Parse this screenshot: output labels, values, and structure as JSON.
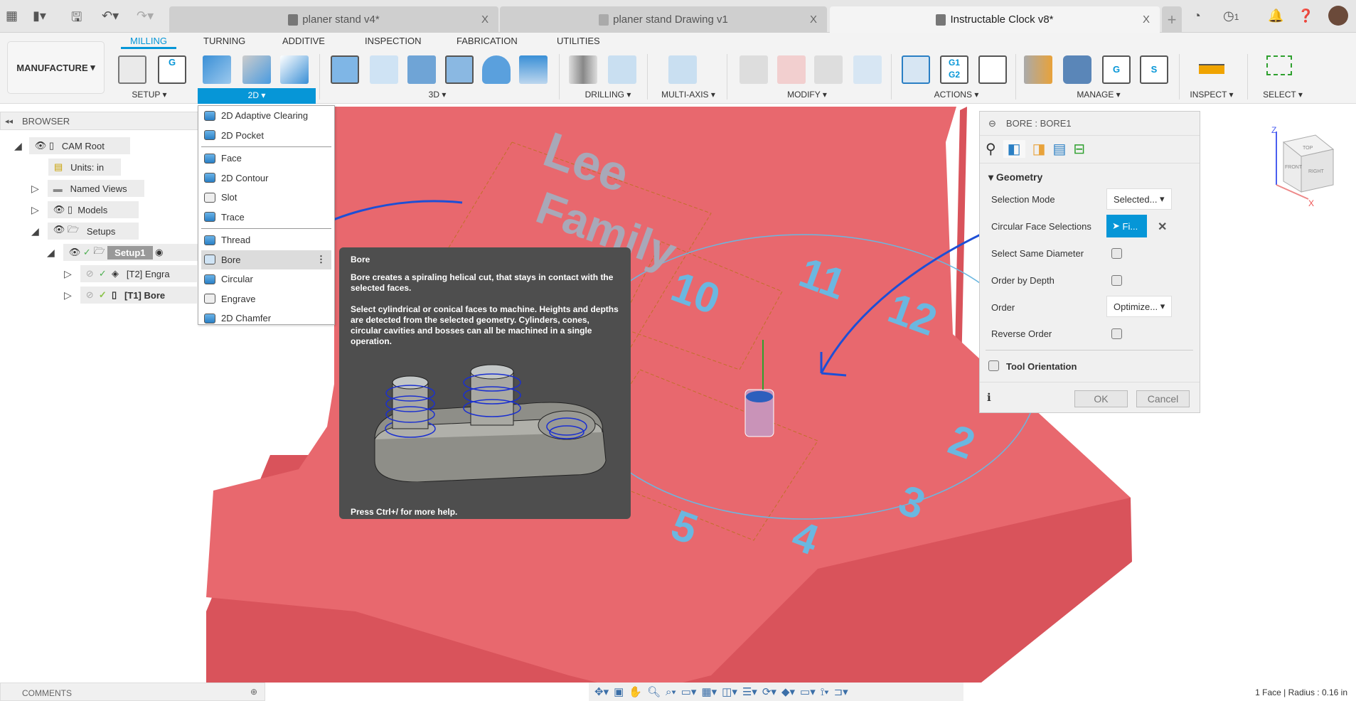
{
  "quick_access": {
    "apps_icon": "grid-icon",
    "file_icon": "file-icon",
    "save_icon": "save-icon",
    "undo_icon": "undo-icon",
    "redo_icon": "redo-icon"
  },
  "doc_tabs": [
    {
      "label": "planer stand v4*",
      "active": false
    },
    {
      "label": "planer stand Drawing v1",
      "active": false
    },
    {
      "label": "Instructable Clock v8*",
      "active": true
    }
  ],
  "top_right": {
    "jobs_count": "1",
    "new_tab": "+"
  },
  "workspace": "MANUFACTURE",
  "ribbon_tabs": [
    "MILLING",
    "TURNING",
    "ADDITIVE",
    "INSPECTION",
    "FABRICATION",
    "UTILITIES"
  ],
  "active_ribbon_tab": "MILLING",
  "groups": [
    "SETUP",
    "2D",
    "3D",
    "DRILLING",
    "MULTI-AXIS",
    "MODIFY",
    "ACTIONS",
    "MANAGE",
    "INSPECT",
    "SELECT"
  ],
  "active_group": "2D",
  "browser": {
    "title": "BROWSER",
    "nodes": [
      {
        "label": "CAM Root"
      },
      {
        "label": "Units: in"
      },
      {
        "label": "Named Views"
      },
      {
        "label": "Models"
      },
      {
        "label": "Setups"
      },
      {
        "label": "Setup1"
      },
      {
        "label": "[T2] Engra"
      },
      {
        "label": "[T1] Bore"
      }
    ]
  },
  "dropdown_2d": [
    {
      "label": "2D Adaptive Clearing"
    },
    {
      "label": "2D Pocket"
    },
    {
      "label": "Face"
    },
    {
      "label": "2D Contour"
    },
    {
      "label": "Slot"
    },
    {
      "label": "Trace"
    },
    {
      "label": "Thread"
    },
    {
      "label": "Bore",
      "highlighted": true
    },
    {
      "label": "Circular"
    },
    {
      "label": "Engrave"
    },
    {
      "label": "2D Chamfer"
    }
  ],
  "tooltip": {
    "title": "Bore",
    "p1": "Bore creates a spiraling helical cut, that stays in contact with the selected faces.",
    "p2": "Select cylindrical or conical faces to machine. Heights and depths are detected from the selected geometry. Cylinders, cones, circular cavities and bosses can all be machined in a single operation.",
    "footer": "Press Ctrl+/ for more help."
  },
  "panel": {
    "title": "BORE : BORE1",
    "section": "Geometry",
    "rows": {
      "selection_mode": "Selection Mode",
      "circular_faces": "Circular Face Selections",
      "same_diameter": "Select Same Diameter",
      "order_by_depth": "Order by Depth",
      "order": "Order",
      "reverse_order": "Reverse Order"
    },
    "selection_mode_value": "Selected...",
    "faces_button": "Fi...",
    "order_value": "Optimize...",
    "select_same_diameter": false,
    "order_by_depth_checked": false,
    "reverse_order_checked": false,
    "tool_orientation": "Tool Orientation",
    "tool_orientation_checked": false,
    "ok": "OK",
    "cancel": "Cancel"
  },
  "viewcube": {
    "top": "TOP",
    "front": "FRONT",
    "right": "RIGHT",
    "z": "Z",
    "x": "X"
  },
  "scene": {
    "text1": "Lee",
    "text2": "Family",
    "numbers": [
      "10",
      "11",
      "12",
      "2",
      "3",
      "4",
      "5"
    ]
  },
  "comments": "COMMENTS",
  "status": "1 Face | Radius : 0.16 in",
  "colors": {
    "accent": "#0696d7",
    "model": "#e8666c",
    "tooltip_bg": "#4e4e4e"
  }
}
